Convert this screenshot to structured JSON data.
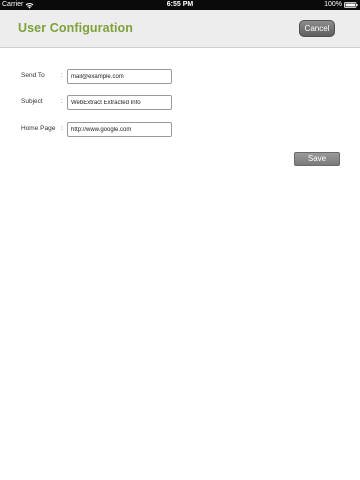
{
  "status_bar": {
    "carrier": "Carrier",
    "time": "6:55 PM",
    "battery": "100%"
  },
  "header": {
    "title": "User Configuration",
    "cancel_label": "Cancel",
    "title_color": "#7ea13a"
  },
  "form": {
    "send_to": {
      "label": "Send To",
      "separator": ":",
      "value": "mail@example.com"
    },
    "subject": {
      "label": "Subject",
      "separator": ":",
      "value": "WebExtract Extracted Info"
    },
    "home_page": {
      "label": "Home Page",
      "separator": ":",
      "value": "http://www.google.com"
    },
    "save_label": "Save"
  }
}
